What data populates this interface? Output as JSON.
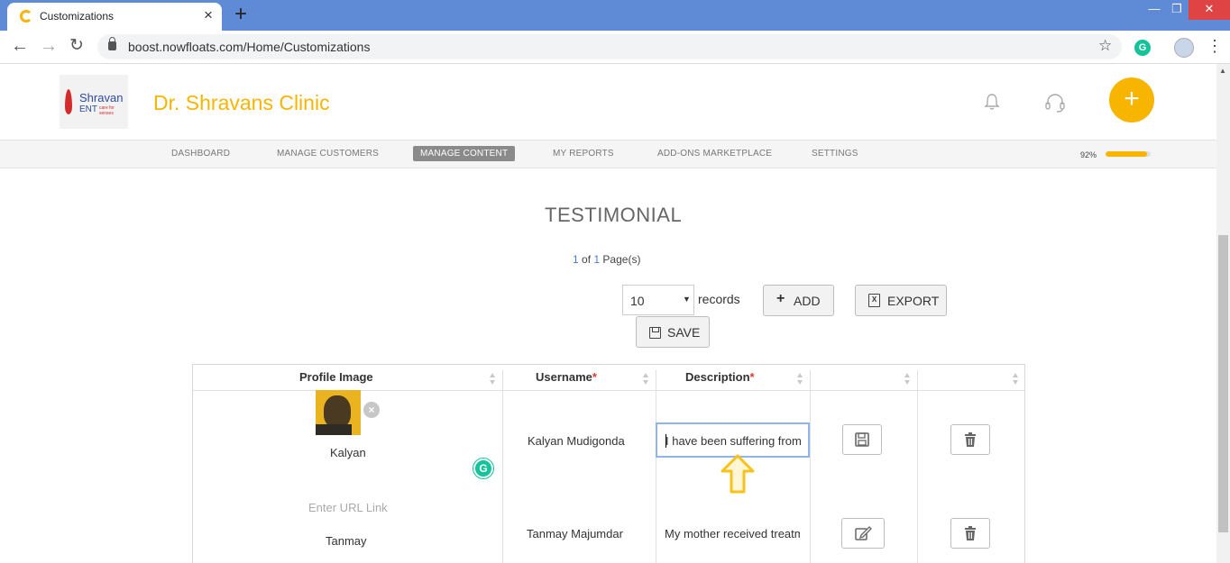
{
  "browser": {
    "tab_title": "Customizations",
    "new_tab_glyph": "+",
    "tab_close_glyph": "×",
    "url": "boost.nowfloats.com/Home/Customizations",
    "icons": [
      "back-arrow-icon",
      "forward-arrow-icon",
      "reload-icon",
      "lock-icon",
      "star-icon",
      "grammarly-icon",
      "profile-icon",
      "menu-kebab-icon"
    ]
  },
  "header": {
    "logo": {
      "line1": "Shravan",
      "line2": "ENT",
      "tagline": "care for senses"
    },
    "clinic_name": "Dr. Shravans Clinic",
    "fab_glyph": "+",
    "brand_color": "#f7b500"
  },
  "nav": {
    "items": [
      "DASHBOARD",
      "MANAGE CUSTOMERS",
      "MANAGE CONTENT",
      "MY REPORTS",
      "ADD-ONS MARKETPLACE",
      "SETTINGS"
    ],
    "active": "MANAGE CONTENT",
    "progress_label": "92%",
    "progress_value": 0.92
  },
  "content": {
    "title": "TESTIMONIAL",
    "pager": {
      "current": "1",
      "of": "of",
      "total": "1",
      "suffix": "Page(s)"
    },
    "records_value": "10",
    "records_label": "records",
    "add_label": "ADD",
    "export_label": "EXPORT",
    "save_label": "SAVE"
  },
  "table": {
    "headers": [
      "Profile Image",
      "Username",
      "Description",
      "",
      ""
    ],
    "required_marker": "*",
    "rows": [
      {
        "name": "Kalyan",
        "username": "Kalyan Mudigonda",
        "description": "I have been suffering from",
        "mode": "editing"
      },
      {
        "url_placeholder": "Enter URL Link",
        "name": "Tanmay",
        "username": "Tanmay Majumdar",
        "description": "My mother received treatment",
        "mode": "view"
      }
    ]
  }
}
